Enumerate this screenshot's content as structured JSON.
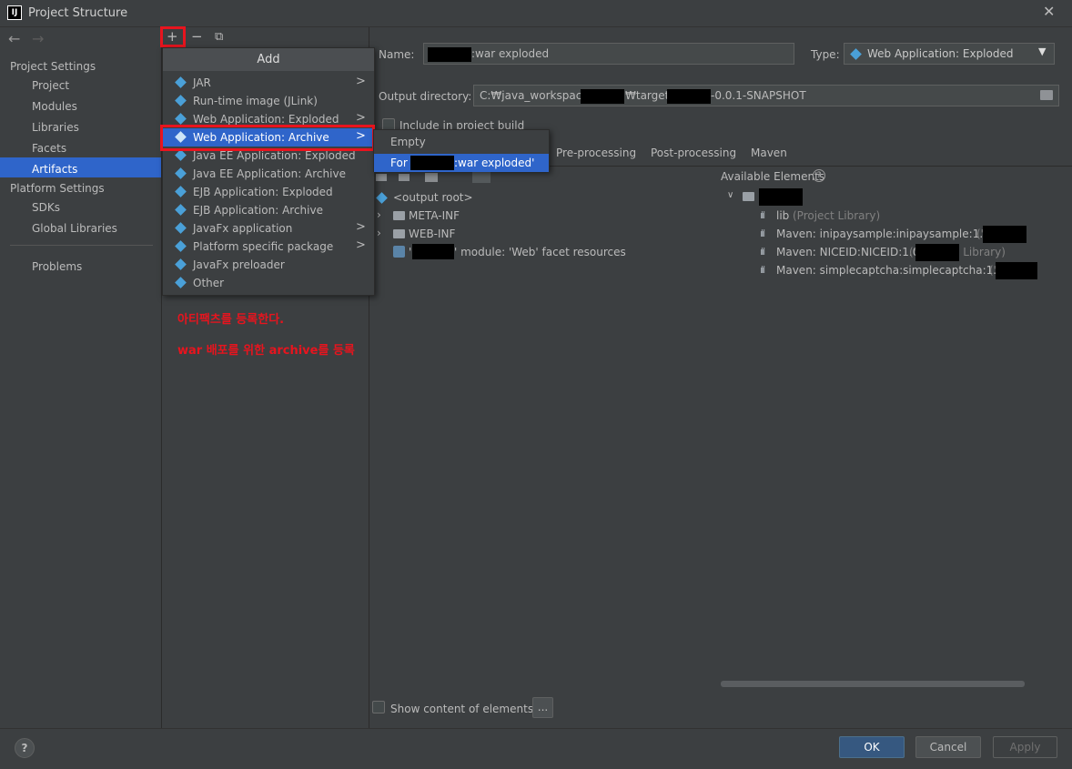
{
  "window": {
    "title": "Project Structure",
    "logo": "IJ"
  },
  "nav": {
    "back": "←",
    "forward": "→"
  },
  "sidebar": {
    "project_settings": "Project Settings",
    "items": [
      "Project",
      "Modules",
      "Libraries",
      "Facets",
      "Artifacts"
    ],
    "platform_settings": "Platform Settings",
    "platform_items": [
      "SDKs",
      "Global Libraries"
    ],
    "problems": "Problems"
  },
  "toolbar": {
    "add": "+",
    "remove": "−",
    "copy": "⧉"
  },
  "popup": {
    "header": "Add",
    "items": [
      {
        "label": "JAR",
        "submenu": true
      },
      {
        "label": "Run-time image (JLink)",
        "submenu": false
      },
      {
        "label": "Web Application: Exploded",
        "submenu": true
      },
      {
        "label": "Web Application: Archive",
        "submenu": true
      },
      {
        "label": "Java EE Application: Exploded",
        "submenu": false
      },
      {
        "label": "Java EE Application: Archive",
        "submenu": false
      },
      {
        "label": "EJB Application: Exploded",
        "submenu": false
      },
      {
        "label": "EJB Application: Archive",
        "submenu": false
      },
      {
        "label": "JavaFx application",
        "submenu": true
      },
      {
        "label": "Platform specific package",
        "submenu": true
      },
      {
        "label": "JavaFx preloader",
        "submenu": false
      },
      {
        "label": "Other",
        "submenu": false
      }
    ],
    "arrow": ">"
  },
  "submenu": {
    "empty": "Empty",
    "for_prefix": "For",
    "for_suffix": ":war exploded'"
  },
  "annotation": {
    "line1": "아티팩츠를 등록한다.",
    "line2": "war 배포를 위한 archive를 등록"
  },
  "form": {
    "name_label": "Name:",
    "name_suffix": ":war exploded",
    "type_label": "Type:",
    "type_value": "Web Application: Exploded",
    "output_label": "Output directory:",
    "output_p1": "C:₩java_workspace₩",
    "output_p2": "₩target₩",
    "output_p3": "-0.0.1-SNAPSHOT",
    "include_label": "Include in project build"
  },
  "tabs": [
    "Pre-processing",
    "Post-processing",
    "Maven"
  ],
  "tree": {
    "output_root": "<output root>",
    "meta_inf": "META-INF",
    "web_inf": "WEB-INF",
    "facet_prefix": "'",
    "facet_suffix": "' module: 'Web' facet resources"
  },
  "available": {
    "label": "Available Elements",
    "help": "?",
    "libs": [
      {
        "name": "lib",
        "kind": "(Project Library)"
      },
      {
        "name": "Maven: inipaysample:inipaysample:1.3.0",
        "kind": "(' Module"
      },
      {
        "name": "Maven: NICEID:NICEID:1.0",
        "kind": "(' Module Library)"
      },
      {
        "name": "Maven: simplecaptcha:simplecaptcha:1.2.1",
        "kind": "(' Modu"
      }
    ]
  },
  "show_content": {
    "label": "Show content of elements",
    "ellipsis": "..."
  },
  "buttons": {
    "ok": "OK",
    "cancel": "Cancel",
    "apply": "Apply",
    "help": "?"
  },
  "colors": {
    "accent": "#2f65ca",
    "highlight_red": "#e8141e",
    "background": "#3c3f41"
  }
}
